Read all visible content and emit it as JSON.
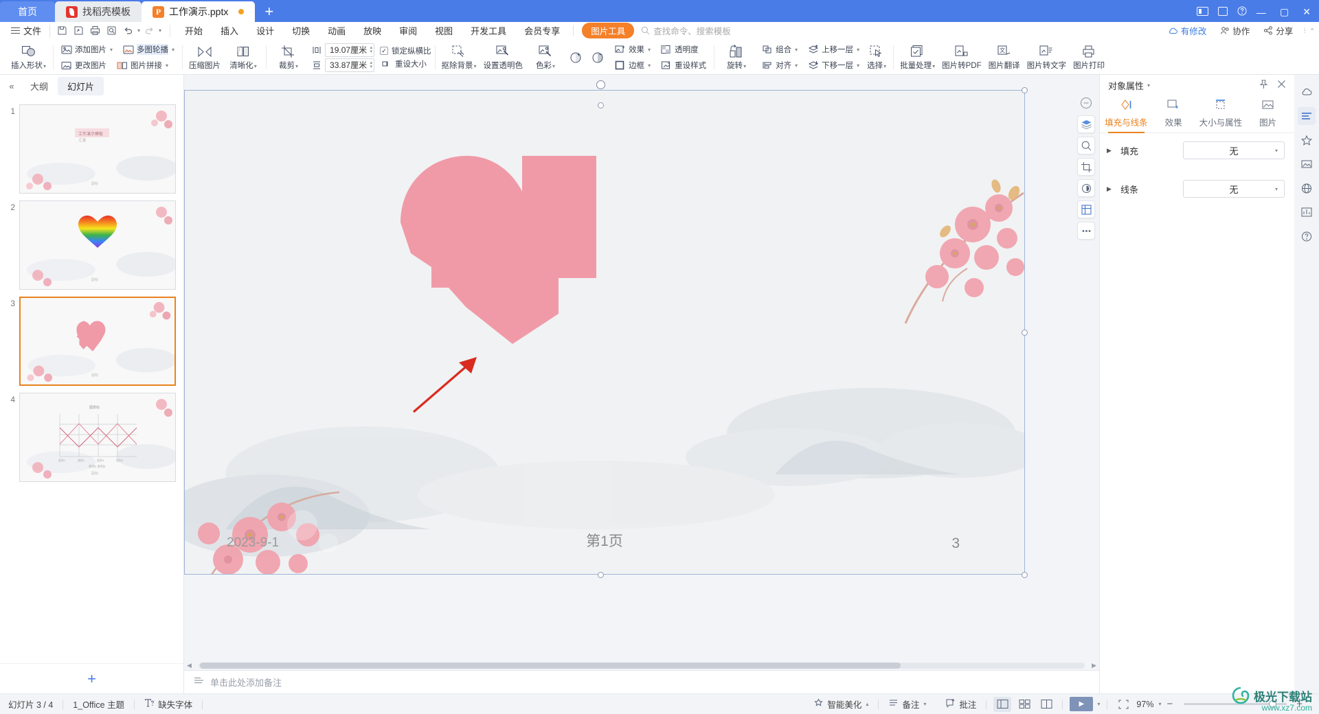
{
  "window": {
    "tabs": [
      {
        "label": "首页",
        "type": "home"
      },
      {
        "label": "找稻壳模板",
        "type": "grey",
        "icon": "docer-icon"
      },
      {
        "label": "工作演示.pptx",
        "type": "active",
        "icon": "ppt-icon",
        "modified": true
      }
    ],
    "new_tab_label": "+",
    "controls": {
      "minimize": "—",
      "maximize": "▢",
      "close": "✕"
    }
  },
  "menubar": {
    "file_label": "文件",
    "quick_access": [
      "save-icon",
      "save-as-icon",
      "print-icon",
      "print-preview-icon",
      "undo-icon",
      "redo-icon",
      "customize-icon"
    ],
    "menus": [
      "开始",
      "插入",
      "设计",
      "切换",
      "动画",
      "放映",
      "审阅",
      "视图",
      "开发工具",
      "会员专享"
    ],
    "context_tab": "图片工具",
    "search_placeholder": "查找命令、搜索模板",
    "right_items": [
      {
        "label": "有修改",
        "icon": "cloud-icon"
      },
      {
        "label": "协作",
        "icon": "collab-icon"
      },
      {
        "label": "分享",
        "icon": "share-icon"
      }
    ]
  },
  "ribbon": {
    "groups": [
      {
        "name": "shape-group",
        "big": [
          {
            "label": "插入形状",
            "icon": "shapes-icon",
            "dropdown": true
          }
        ]
      },
      {
        "name": "picture-group",
        "small": [
          {
            "label": "添加图片",
            "icon": "add-picture-icon",
            "dropdown": true
          },
          {
            "label": "更改图片",
            "icon": "change-picture-icon",
            "dropdown": false
          },
          {
            "label": "多图轮播",
            "icon": "carousel-icon",
            "dropdown": true
          },
          {
            "label": "图片拼接",
            "icon": "picture-collage-icon",
            "dropdown": true
          }
        ]
      },
      {
        "name": "compress-group",
        "big": [
          {
            "label": "压缩图片",
            "icon": "compress-icon",
            "dropdown": false
          },
          {
            "label": "清晰化",
            "icon": "sharpen-icon",
            "dropdown": true
          }
        ]
      },
      {
        "name": "crop-group",
        "big": [
          {
            "label": "裁剪",
            "icon": "crop-icon",
            "dropdown": true
          }
        ],
        "fields": [
          {
            "name": "height",
            "icon": "height-icon",
            "value": "19.07厘米"
          },
          {
            "name": "width",
            "icon": "width-icon",
            "value": "33.87厘米"
          }
        ],
        "checks": [
          {
            "label": "锁定纵横比",
            "checked": true
          },
          {
            "label": "重设大小",
            "checked": false,
            "icon": "reset-size-icon"
          }
        ]
      },
      {
        "name": "adjust-group",
        "big": [
          {
            "label": "抠除背景",
            "icon": "remove-bg-icon",
            "dropdown": true
          },
          {
            "label": "设置透明色",
            "icon": "set-transparent-icon",
            "dropdown": false
          },
          {
            "label": "色彩",
            "icon": "color-icon",
            "dropdown": true
          },
          {
            "label": "",
            "icon": "brightness-up-icon",
            "dropdown": false
          },
          {
            "label": "",
            "icon": "brightness-down-icon",
            "dropdown": false
          }
        ],
        "small": [
          {
            "label": "效果",
            "icon": "effects-icon",
            "dropdown": true
          },
          {
            "label": "透明度",
            "icon": "transparency-icon",
            "dropdown": false
          },
          {
            "label": "边框",
            "icon": "border-icon",
            "dropdown": true
          },
          {
            "label": "重设样式",
            "icon": "reset-style-icon",
            "dropdown": false
          }
        ]
      },
      {
        "name": "arrange-group",
        "big": [
          {
            "label": "旋转",
            "icon": "rotate-icon",
            "dropdown": true
          }
        ],
        "small": [
          {
            "label": "组合",
            "icon": "group-icon",
            "dropdown": true
          },
          {
            "label": "上移一层",
            "icon": "bring-forward-icon",
            "dropdown": true
          },
          {
            "label": "对齐",
            "icon": "align-icon",
            "dropdown": true
          },
          {
            "label": "下移一层",
            "icon": "send-backward-icon",
            "dropdown": true
          }
        ],
        "select": {
          "label": "选择",
          "icon": "select-pane-icon",
          "dropdown": true
        }
      },
      {
        "name": "tools-group",
        "big": [
          {
            "label": "批量处理",
            "icon": "batch-icon",
            "dropdown": true
          },
          {
            "label": "图片转PDF",
            "icon": "pic-to-pdf-icon",
            "dropdown": false
          },
          {
            "label": "图片翻译",
            "icon": "pic-translate-icon",
            "dropdown": false
          },
          {
            "label": "图片转文字",
            "icon": "pic-to-text-icon",
            "dropdown": false
          },
          {
            "label": "图片打印",
            "icon": "pic-print-icon",
            "dropdown": false
          }
        ]
      }
    ]
  },
  "slide_panel": {
    "tabs": [
      {
        "label": "大纲",
        "active": false
      },
      {
        "label": "幻灯片",
        "active": true
      }
    ],
    "collapse_icon": "collapse-icon",
    "slides": [
      {
        "number": "1",
        "selected": false,
        "kind": "title"
      },
      {
        "number": "2",
        "selected": false,
        "kind": "rainbow-heart"
      },
      {
        "number": "3",
        "selected": true,
        "kind": "pink-heart"
      },
      {
        "number": "4",
        "selected": false,
        "kind": "chart"
      }
    ],
    "add_slide_label": "+"
  },
  "slide": {
    "date_text": "2023-9-1",
    "page_text": "第1页",
    "number_text": "3",
    "shape_color": "#f09aa8",
    "arrow_color": "#d92b1f"
  },
  "side_tools": [
    {
      "icon": "minus-circle-icon",
      "active": false
    },
    {
      "icon": "layers-icon",
      "active": true
    },
    {
      "icon": "zoom-icon",
      "active": false
    },
    {
      "icon": "crop-tool-icon",
      "active": false
    },
    {
      "icon": "color-fill-icon",
      "active": false
    },
    {
      "icon": "grid-icon",
      "active": true
    },
    {
      "icon": "more-dots-icon",
      "active": false
    }
  ],
  "notes": {
    "icon": "notes-icon",
    "placeholder": "单击此处添加备注"
  },
  "object_panel": {
    "title": "对象属性",
    "pin_icon": "pin-icon",
    "close_icon": "close-icon",
    "tabs": [
      {
        "label": "填充与线条",
        "icon": "fill-line-icon",
        "active": true
      },
      {
        "label": "效果",
        "icon": "effects-panel-icon",
        "active": false
      },
      {
        "label": "大小与属性",
        "icon": "size-props-icon",
        "active": false
      },
      {
        "label": "图片",
        "icon": "picture-panel-icon",
        "active": false
      }
    ],
    "rows": [
      {
        "label": "填充",
        "value": "无"
      },
      {
        "label": "线条",
        "value": "无"
      }
    ]
  },
  "rail": [
    {
      "icon": "cloud-rail-icon",
      "active": false
    },
    {
      "icon": "properties-rail-icon",
      "active": true
    },
    {
      "icon": "star-rail-icon",
      "active": false
    },
    {
      "icon": "picture-rail-icon",
      "active": false
    },
    {
      "icon": "globe-rail-icon",
      "active": false
    },
    {
      "icon": "chart-rail-icon",
      "active": false
    },
    {
      "icon": "help-rail-icon",
      "active": false
    }
  ],
  "status": {
    "slide_count": "幻灯片 3 / 4",
    "theme": "1_Office 主题",
    "font_warning": "缺失字体",
    "font_warning_icon": "missing-font-icon",
    "beautify": "智能美化",
    "remarks": "备注",
    "comments": "批注",
    "views": [
      {
        "icon": "normal-view-icon",
        "active": true
      },
      {
        "icon": "sorter-view-icon",
        "active": false
      },
      {
        "icon": "reading-view-icon",
        "active": false
      }
    ],
    "play_icon": "play-icon",
    "fit_icon": "fit-icon",
    "zoom_value": "97%",
    "zoom_minus": "−",
    "zoom_plus": "+",
    "watermark_main": "极光下载站",
    "watermark_sub": "www.xz7.com"
  }
}
